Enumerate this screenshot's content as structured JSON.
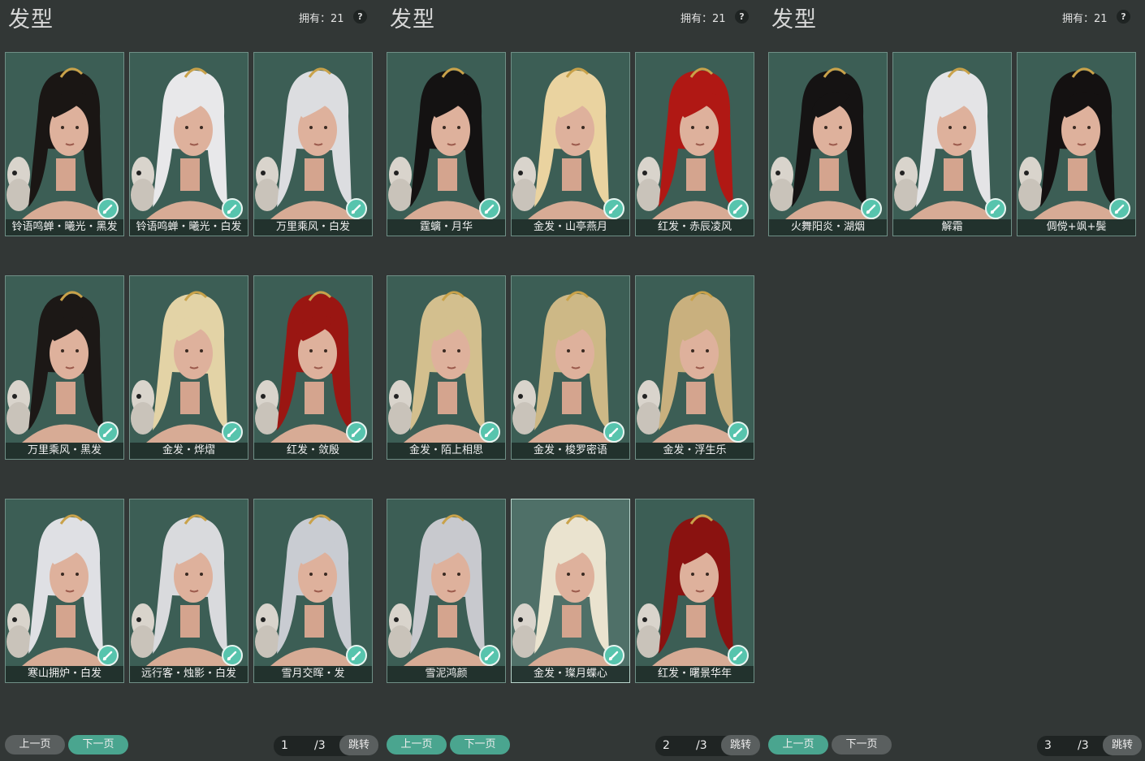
{
  "colors": {
    "card_bg": "#3c5e55",
    "accent": "#4aa58f",
    "page_bg": "#323736"
  },
  "panels": [
    {
      "title": "发型",
      "owned": "拥有：21",
      "help": "?",
      "items": [
        {
          "label": "铃语鸣蝉・曦光・黑发",
          "hair": "#1a1614"
        },
        {
          "label": "铃语鸣蝉・曦光・白发",
          "hair": "#e8e8ea"
        },
        {
          "label": "万里乘风・白发",
          "hair": "#dcdde0"
        },
        {
          "label": "万里乘风・黑发",
          "hair": "#1c1816"
        },
        {
          "label": "金发・烨熠",
          "hair": "#e3d3a6"
        },
        {
          "label": "红发・敛殷",
          "hair": "#9a1612"
        },
        {
          "label": "寒山拥炉・白发",
          "hair": "#dfe0e4"
        },
        {
          "label": "远行客・烛影・白发",
          "hair": "#d9dadd"
        },
        {
          "label": "雪月交晖・发",
          "hair": "#c9ccd2"
        }
      ],
      "prev": "上一页",
      "next": "下一页",
      "page": "1",
      "total": "/3",
      "jump": "跳转"
    },
    {
      "title": "发型",
      "owned": "拥有：21",
      "help": "?",
      "items": [
        {
          "label": "霆螭・月华",
          "hair": "#141212"
        },
        {
          "label": "金发・山亭燕月",
          "hair": "#ead3a0"
        },
        {
          "label": "红发・赤辰凌风",
          "hair": "#b01814"
        },
        {
          "label": "金发・陌上相思",
          "hair": "#d3bf8e"
        },
        {
          "label": "金发・梭罗密语",
          "hair": "#cdb886"
        },
        {
          "label": "金发・浮生乐",
          "hair": "#c9b07e"
        },
        {
          "label": "雪泥鸿颜",
          "hair": "#c8c9ce"
        },
        {
          "label": "金发・璨月蝶心",
          "hair": "#eae3cf"
        },
        {
          "label": "红发・曙景华年",
          "hair": "#8a1210"
        }
      ],
      "prev": "上一页",
      "next": "下一页",
      "page": "2",
      "total": "/3",
      "jump": "跳转"
    },
    {
      "title": "发型",
      "owned": "拥有：21",
      "help": "?",
      "items": [
        {
          "label": "火舞阳炎・湖烟",
          "hair": "#151313"
        },
        {
          "label": "解霜",
          "hair": "#e4e4e6"
        },
        {
          "label": "倜傥+飒+鬓",
          "hair": "#141111"
        }
      ],
      "prev": "上一页",
      "next": "下一页",
      "page": "3",
      "total": "/3",
      "jump": "跳转"
    }
  ]
}
